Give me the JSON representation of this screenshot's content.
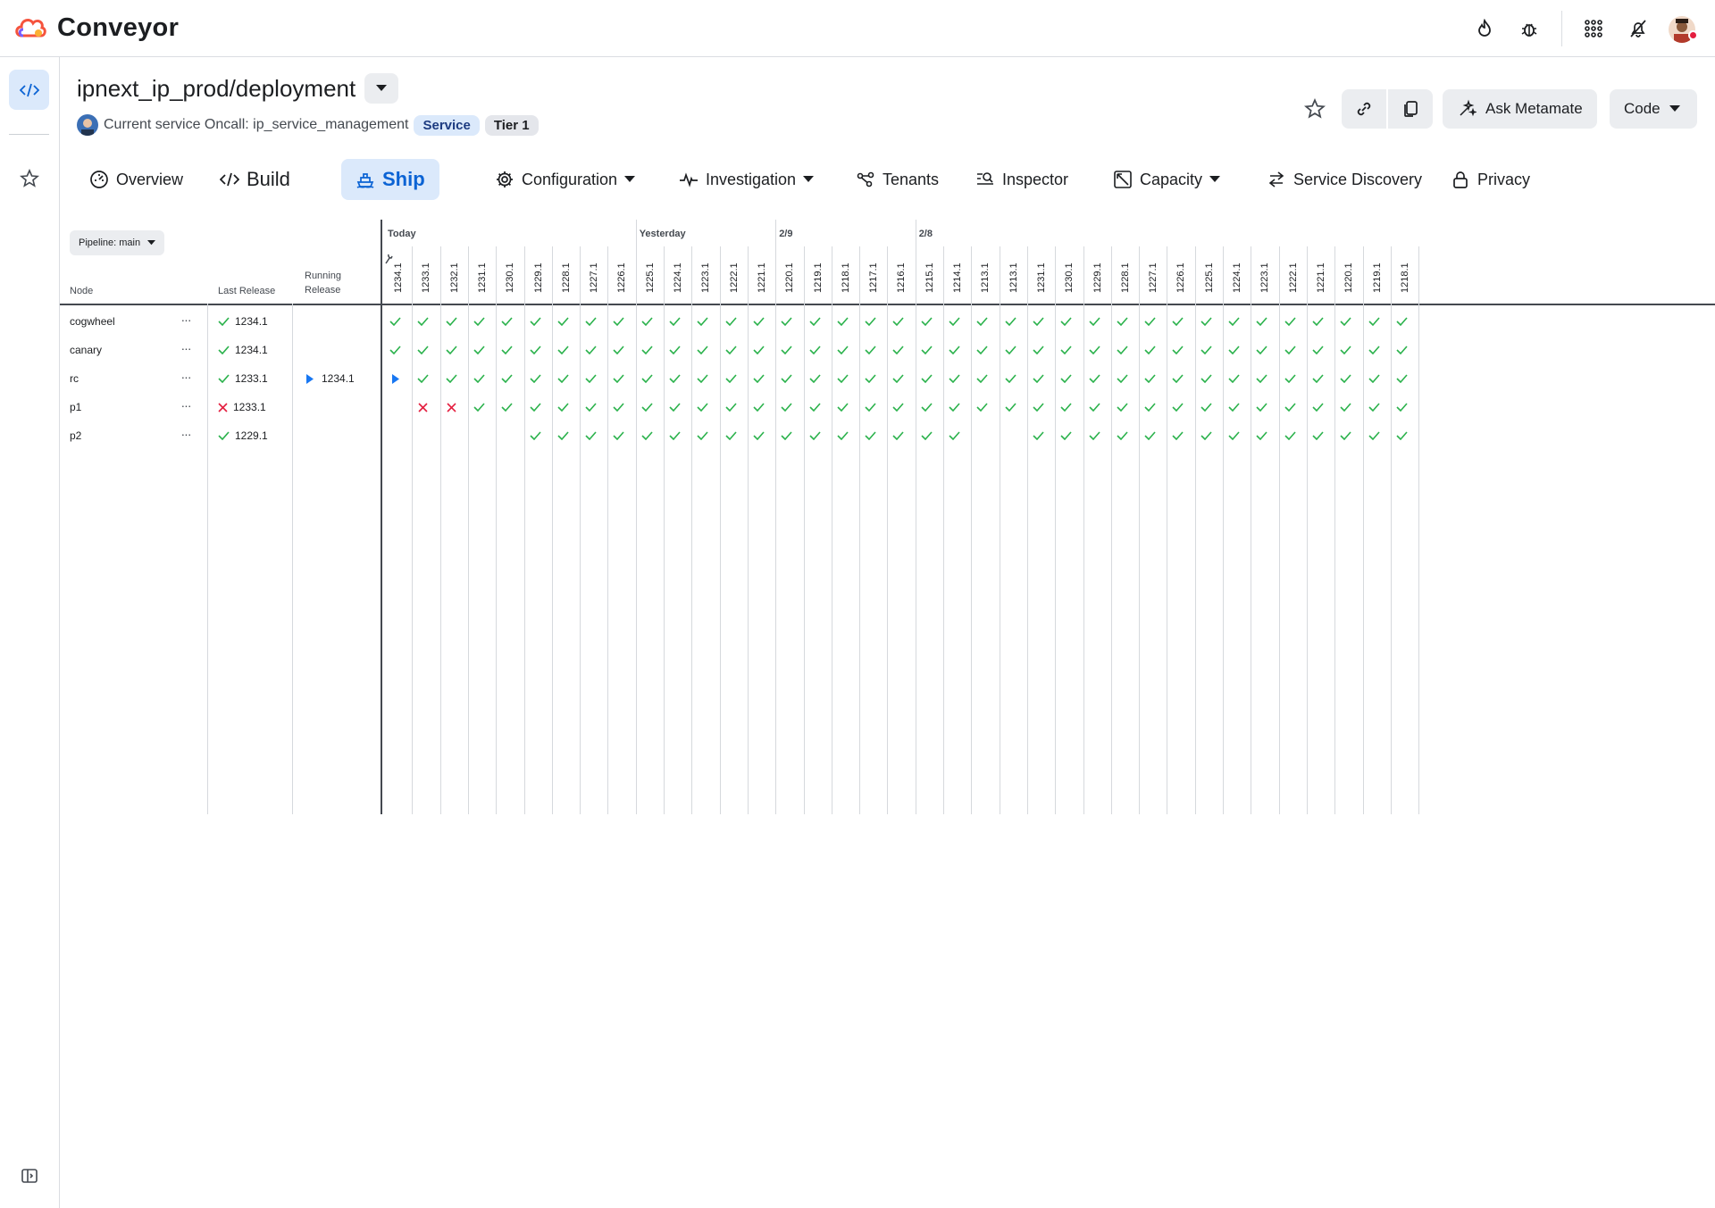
{
  "app": {
    "name": "Conveyor"
  },
  "topbar": {
    "icons": [
      "flame-icon",
      "bug-icon",
      "apps-grid-icon",
      "bell-off-icon"
    ],
    "has_notification": true
  },
  "header": {
    "title": "ipnext_ip_prod/deployment",
    "oncall_text": "Current service Oncall: ip_service_management",
    "badges": {
      "service": "Service",
      "tier": "Tier 1"
    },
    "ask_label": "Ask Metamate",
    "code_label": "Code"
  },
  "tabs": [
    {
      "label": "Overview",
      "icon": "gauge-icon"
    },
    {
      "label": "Build",
      "icon": "code-icon"
    },
    {
      "label": "Ship",
      "icon": "ship-icon",
      "active": true
    },
    {
      "label": "Configuration",
      "icon": "gear-icon",
      "dropdown": true
    },
    {
      "label": "Investigation",
      "icon": "pulse-icon",
      "dropdown": true
    },
    {
      "label": "Tenants",
      "icon": "tenants-icon"
    },
    {
      "label": "Inspector",
      "icon": "inspector-icon"
    },
    {
      "label": "Capacity",
      "icon": "capacity-icon",
      "dropdown": true
    },
    {
      "label": "Service Discovery",
      "icon": "arrows-icon"
    },
    {
      "label": "Privacy",
      "icon": "lock-icon"
    }
  ],
  "grid": {
    "pipeline_label": "Pipeline: main",
    "headers": {
      "node": "Node",
      "last_release": "Last Release",
      "running_release_1": "Running",
      "running_release_2": "Release"
    },
    "groups": [
      {
        "label": "Today",
        "start": 0
      },
      {
        "label": "Yesterday",
        "start": 9
      },
      {
        "label": "2/9",
        "start": 14
      },
      {
        "label": "2/8",
        "start": 19
      }
    ],
    "versions": [
      "1234.1",
      "1233.1",
      "1232.1",
      "1231.1",
      "1230.1",
      "1229.1",
      "1228.1",
      "1227.1",
      "1226.1",
      "1225.1",
      "1224.1",
      "1223.1",
      "1222.1",
      "1221.1",
      "1220.1",
      "1219.1",
      "1218.1",
      "1217.1",
      "1216.1",
      "1215.1",
      "1214.1",
      "1213.1",
      "1213.1",
      "1231.1",
      "1230.1",
      "1229.1",
      "1228.1",
      "1227.1",
      "1226.1",
      "1225.1",
      "1224.1",
      "1223.1",
      "1222.1",
      "1221.1",
      "1220.1",
      "1219.1",
      "1218.1"
    ],
    "rows": [
      {
        "node": "cogwheel",
        "last_status": "ok",
        "last_release": "1234.1",
        "running_release": "",
        "cells": "ccccccccccccccccccccccccccccccccccccc"
      },
      {
        "node": "canary",
        "last_status": "ok",
        "last_release": "1234.1",
        "running_release": "",
        "cells": "ccccccccccccccccccccccccccccccccccccc"
      },
      {
        "node": "rc",
        "last_status": "ok",
        "last_release": "1233.1",
        "running_release": "1234.1",
        "cells": "pcccccccccccccccccccccccccccccccccccc"
      },
      {
        "node": "p1",
        "last_status": "fail",
        "last_release": "1233.1",
        "running_release": "",
        "cells": "-xxcccccccccccccccccccccccccccccccccc"
      },
      {
        "node": "p2",
        "last_status": "ok",
        "last_release": "1229.1",
        "running_release": "",
        "cells": "-----cccccccccccccccc--cccccccccccccc"
      }
    ]
  },
  "colors": {
    "ok": "#2bb24c",
    "fail": "#e41e3f",
    "running": "#1877f2",
    "accent": "#0b63d4"
  }
}
